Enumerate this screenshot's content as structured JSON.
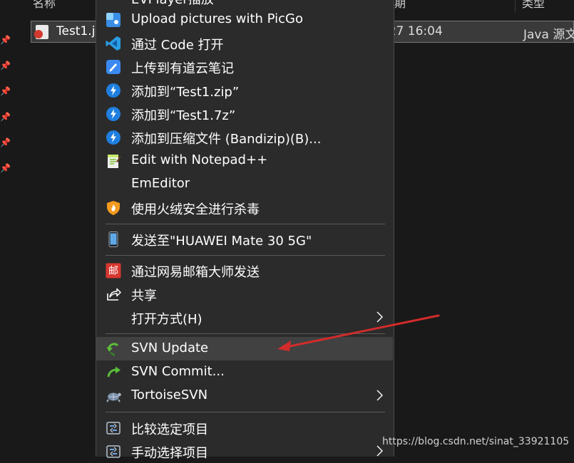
{
  "explorer": {
    "columns": {
      "name": "名称",
      "date": "期",
      "type": "类型"
    },
    "file": {
      "name": "Test1.j",
      "date": "/27 16:04",
      "type": "Java 源文"
    }
  },
  "menu": {
    "items": [
      {
        "label": "Upload pictures with PicGo",
        "icon": "picgo-icon"
      },
      {
        "label": "通过 Code 打开",
        "icon": "vscode-icon"
      },
      {
        "label": "上传到有道云笔记",
        "icon": "youdao-note-icon"
      },
      {
        "label": "添加到“Test1.zip”",
        "icon": "bandizip-icon"
      },
      {
        "label": "添加到“Test1.7z”",
        "icon": "bandizip-icon"
      },
      {
        "label": "添加到压缩文件 (Bandizip)(B)...",
        "icon": "bandizip-icon"
      },
      {
        "label": "Edit with Notepad++",
        "icon": "notepadpp-icon"
      },
      {
        "label": "EmEditor",
        "icon": ""
      },
      {
        "label": "使用火绒安全进行杀毒",
        "icon": "huorong-shield-icon"
      },
      {
        "label": "发送至\"HUAWEI Mate 30 5G\"",
        "icon": "phone-icon"
      },
      {
        "label": "通过网易邮箱大师发送",
        "icon": "netease-mail-icon"
      },
      {
        "label": "共享",
        "icon": "share-icon"
      },
      {
        "label": "打开方式(H)",
        "icon": ""
      },
      {
        "label": "SVN Update",
        "icon": "svn-update-icon"
      },
      {
        "label": "SVN Commit...",
        "icon": "svn-commit-icon"
      },
      {
        "label": "TortoiseSVN",
        "icon": "tortoisesvn-icon"
      },
      {
        "label": "比较选定项目",
        "icon": "compare-icon"
      },
      {
        "label": "手动选择项目",
        "icon": "compare-icon"
      }
    ],
    "top_partial_label": "EVPlayer插放"
  },
  "watermark": "https://blog.csdn.net/sinat_33921105",
  "colors": {
    "menu_bg": "#2b2b2b",
    "hover_bg": "#414141",
    "arrow_red": "#d22b2b",
    "page_bg": "#191919"
  }
}
